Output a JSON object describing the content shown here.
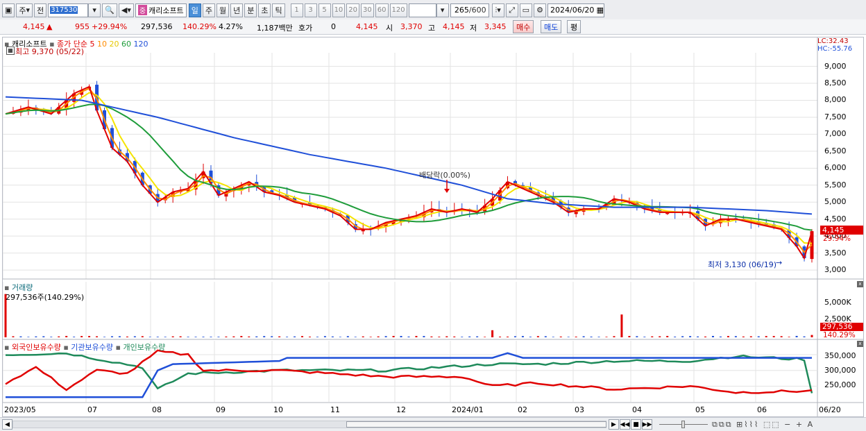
{
  "toolbar": {
    "period": "주",
    "prev_label": "전",
    "stock_code": "317530",
    "badge": "중",
    "stock_name": "캐리소프트",
    "period_tabs": [
      "일",
      "주",
      "월",
      "년",
      "분",
      "초",
      "틱"
    ],
    "active_tab": "일",
    "interval_buttons": [
      "1",
      "3",
      "5",
      "10",
      "20",
      "30",
      "60",
      "120"
    ],
    "bar_count": "265",
    "bar_total": "/600",
    "date": "2024/06/20"
  },
  "info": {
    "price": "4,145",
    "change": "955",
    "change_pct": "+29.94%",
    "volume": "297,536",
    "volume_ratio": "140.29%",
    "turnover": "4.27%",
    "amount": "1,187백만",
    "quote_label": "호가",
    "quote_value": "0",
    "current": "4,145",
    "open_label": "시",
    "open": "3,370",
    "high_label": "고",
    "high": "4,145",
    "low_label": "저",
    "low": "3,345",
    "buy_button": "매수",
    "sell_button": "매도",
    "eval_button": "평"
  },
  "price_panel": {
    "stock_label": "캐리소프트",
    "legend_prefix": "종가 단순",
    "ma_labels": [
      "5",
      "10",
      "20",
      "60",
      "120"
    ],
    "ma_colors": [
      "#e00000",
      "#ff8c00",
      "#f5e400",
      "#1e9c3a",
      "#1f4fd8"
    ],
    "high_note": "최고 9,370 (05/22)",
    "low_note": "최저 3,130 (06/19)",
    "dividend_note": "배당락(0.00%)",
    "lc_label": "LC:32.43",
    "hc_label": "HC:-55.76",
    "price_tag": "4,145",
    "pct_tag": "29.94%",
    "y_ticks": [
      "9,000",
      "8,500",
      "8,000",
      "7,500",
      "7,000",
      "6,500",
      "6,000",
      "5,500",
      "5,000",
      "4,500",
      "4,000",
      "3,500",
      "3,000"
    ]
  },
  "volume_panel": {
    "title": "거래량",
    "value_note": "297,536주(140.29%)",
    "y_ticks": [
      "5,000K",
      "2,500K"
    ],
    "value_tag": "297,536",
    "pct_tag": "140.29%"
  },
  "holdings_panel": {
    "series_labels": [
      "외국인보유수량",
      "기관보유수량",
      "개인보유수량"
    ],
    "series_colors": [
      "#e00000",
      "#1f4fd8",
      "#1e8a5a"
    ],
    "y_ticks": [
      "350,000",
      "300,000",
      "250,000"
    ]
  },
  "x_axis": [
    "2023/05",
    "07",
    "08",
    "09",
    "10",
    "11",
    "12",
    "2024/01",
    "02",
    "03",
    "04",
    "05",
    "06",
    "06/20"
  ],
  "chart_data": {
    "type": "candlestick",
    "ylim": [
      2900,
      9400
    ],
    "dates": [
      "2023/05",
      "07",
      "08",
      "09",
      "10",
      "11",
      "12",
      "2024/01",
      "02",
      "03",
      "04",
      "05",
      "06"
    ],
    "close_path": [
      [
        0,
        7600
      ],
      [
        3,
        7800
      ],
      [
        6,
        7600
      ],
      [
        9,
        8200
      ],
      [
        11,
        8400
      ],
      [
        12,
        7700
      ],
      [
        14,
        6600
      ],
      [
        16,
        6200
      ],
      [
        18,
        5500
      ],
      [
        20,
        5000
      ],
      [
        22,
        5300
      ],
      [
        24,
        5400
      ],
      [
        26,
        5900
      ],
      [
        28,
        5200
      ],
      [
        30,
        5400
      ],
      [
        32,
        5600
      ],
      [
        34,
        5300
      ],
      [
        36,
        5200
      ],
      [
        38,
        5000
      ],
      [
        40,
        4900
      ],
      [
        42,
        4800
      ],
      [
        44,
        4600
      ],
      [
        46,
        4200
      ],
      [
        48,
        4200
      ],
      [
        50,
        4400
      ],
      [
        52,
        4500
      ],
      [
        54,
        4600
      ],
      [
        56,
        4800
      ],
      [
        58,
        4700
      ],
      [
        60,
        4800
      ],
      [
        62,
        4700
      ],
      [
        64,
        5100
      ],
      [
        66,
        5600
      ],
      [
        68,
        5400
      ],
      [
        70,
        5200
      ],
      [
        72,
        5000
      ],
      [
        74,
        4700
      ],
      [
        76,
        4800
      ],
      [
        78,
        4800
      ],
      [
        80,
        5100
      ],
      [
        82,
        5000
      ],
      [
        84,
        4800
      ],
      [
        86,
        4700
      ],
      [
        88,
        4700
      ],
      [
        90,
        4700
      ],
      [
        92,
        4300
      ],
      [
        94,
        4500
      ],
      [
        96,
        4500
      ],
      [
        98,
        4400
      ],
      [
        100,
        4300
      ],
      [
        102,
        4200
      ],
      [
        104,
        3700
      ],
      [
        105,
        3350
      ],
      [
        106,
        4145
      ]
    ],
    "ma_120": [
      [
        0,
        8100
      ],
      [
        10,
        8000
      ],
      [
        20,
        7500
      ],
      [
        30,
        6900
      ],
      [
        40,
        6400
      ],
      [
        50,
        6000
      ],
      [
        60,
        5500
      ],
      [
        66,
        5100
      ],
      [
        72,
        4950
      ],
      [
        80,
        4850
      ],
      [
        90,
        4850
      ],
      [
        100,
        4750
      ],
      [
        106,
        4650
      ]
    ],
    "volume_spikes": [
      {
        "x": 0,
        "v": 5500
      },
      {
        "x": 64,
        "v": 900
      },
      {
        "x": 81,
        "v": 2900
      },
      {
        "x": 106,
        "v": 297.536
      }
    ],
    "holdings": {
      "foreign": [
        [
          0,
          260000
        ],
        [
          4,
          310000
        ],
        [
          8,
          240000
        ],
        [
          12,
          300000
        ],
        [
          16,
          290000
        ],
        [
          20,
          360000
        ],
        [
          24,
          350000
        ],
        [
          26,
          300000
        ],
        [
          36,
          300000
        ],
        [
          50,
          280000
        ],
        [
          60,
          280000
        ],
        [
          64,
          250000
        ],
        [
          70,
          260000
        ],
        [
          80,
          240000
        ],
        [
          90,
          250000
        ],
        [
          96,
          230000
        ],
        [
          106,
          235000
        ]
      ],
      "institution": [
        [
          0,
          215000
        ],
        [
          18,
          215000
        ],
        [
          20,
          300000
        ],
        [
          22,
          320000
        ],
        [
          36,
          330000
        ],
        [
          37,
          340000
        ],
        [
          64,
          340000
        ],
        [
          66,
          355000
        ],
        [
          68,
          340000
        ],
        [
          106,
          340000
        ]
      ],
      "individual": [
        [
          0,
          350000
        ],
        [
          8,
          355000
        ],
        [
          18,
          310000
        ],
        [
          20,
          240000
        ],
        [
          24,
          290000
        ],
        [
          36,
          300000
        ],
        [
          50,
          300000
        ],
        [
          64,
          320000
        ],
        [
          70,
          320000
        ],
        [
          80,
          330000
        ],
        [
          90,
          330000
        ],
        [
          96,
          345000
        ],
        [
          105,
          335000
        ],
        [
          106,
          225000
        ]
      ]
    }
  },
  "navbar": {
    "tools": [
      "▶",
      "◀◀",
      "■",
      "▶▶"
    ]
  }
}
